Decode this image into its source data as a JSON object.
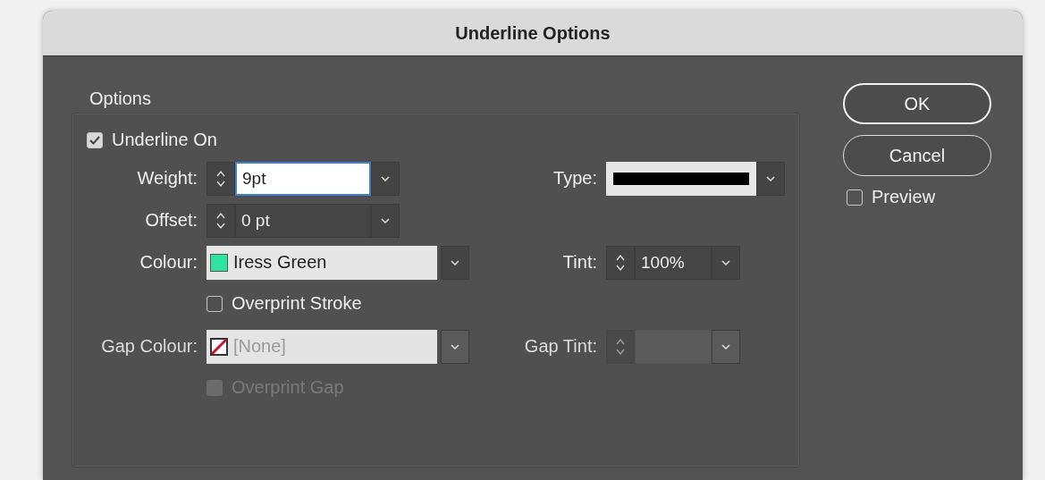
{
  "title": "Underline Options",
  "group_label": "Options",
  "underline_on": {
    "label": "Underline On",
    "checked": true,
    "disabled": false
  },
  "rows": [
    {
      "left": {
        "kind": "spin",
        "label": "Weight:",
        "value": "9pt",
        "focused": true,
        "disabled": false
      },
      "right": {
        "kind": "line",
        "label": "Type:"
      }
    },
    {
      "left": {
        "kind": "spin",
        "label": "Offset:",
        "value": "0 pt",
        "focused": false,
        "disabled": false
      }
    },
    {
      "left": {
        "kind": "swatch",
        "label": "Colour:",
        "value": "Iress Green",
        "swatch": {
          "kind": "solid",
          "color": "#2fe3a0"
        },
        "disabled": false
      },
      "right": {
        "kind": "spin",
        "label": "Tint:",
        "value": "100%",
        "focused": false,
        "disabled": false
      }
    },
    {
      "left": {
        "kind": "check",
        "label": "Overprint Stroke",
        "checked": false,
        "disabled": false
      }
    },
    {
      "left": {
        "kind": "swatch",
        "label": "Gap Colour:",
        "value": "[None]",
        "swatch": {
          "kind": "none"
        },
        "disabled": true
      },
      "right": {
        "kind": "spin",
        "label": "Gap Tint:",
        "focused": false,
        "disabled": true
      }
    },
    {
      "left": {
        "kind": "check",
        "label": "Overprint Gap",
        "disabled": true
      }
    }
  ],
  "buttons": [
    {
      "label": "OK",
      "default": true
    },
    {
      "label": "Cancel",
      "default": false
    }
  ],
  "preview": {
    "label": "Preview",
    "checked": false,
    "disabled": false
  }
}
